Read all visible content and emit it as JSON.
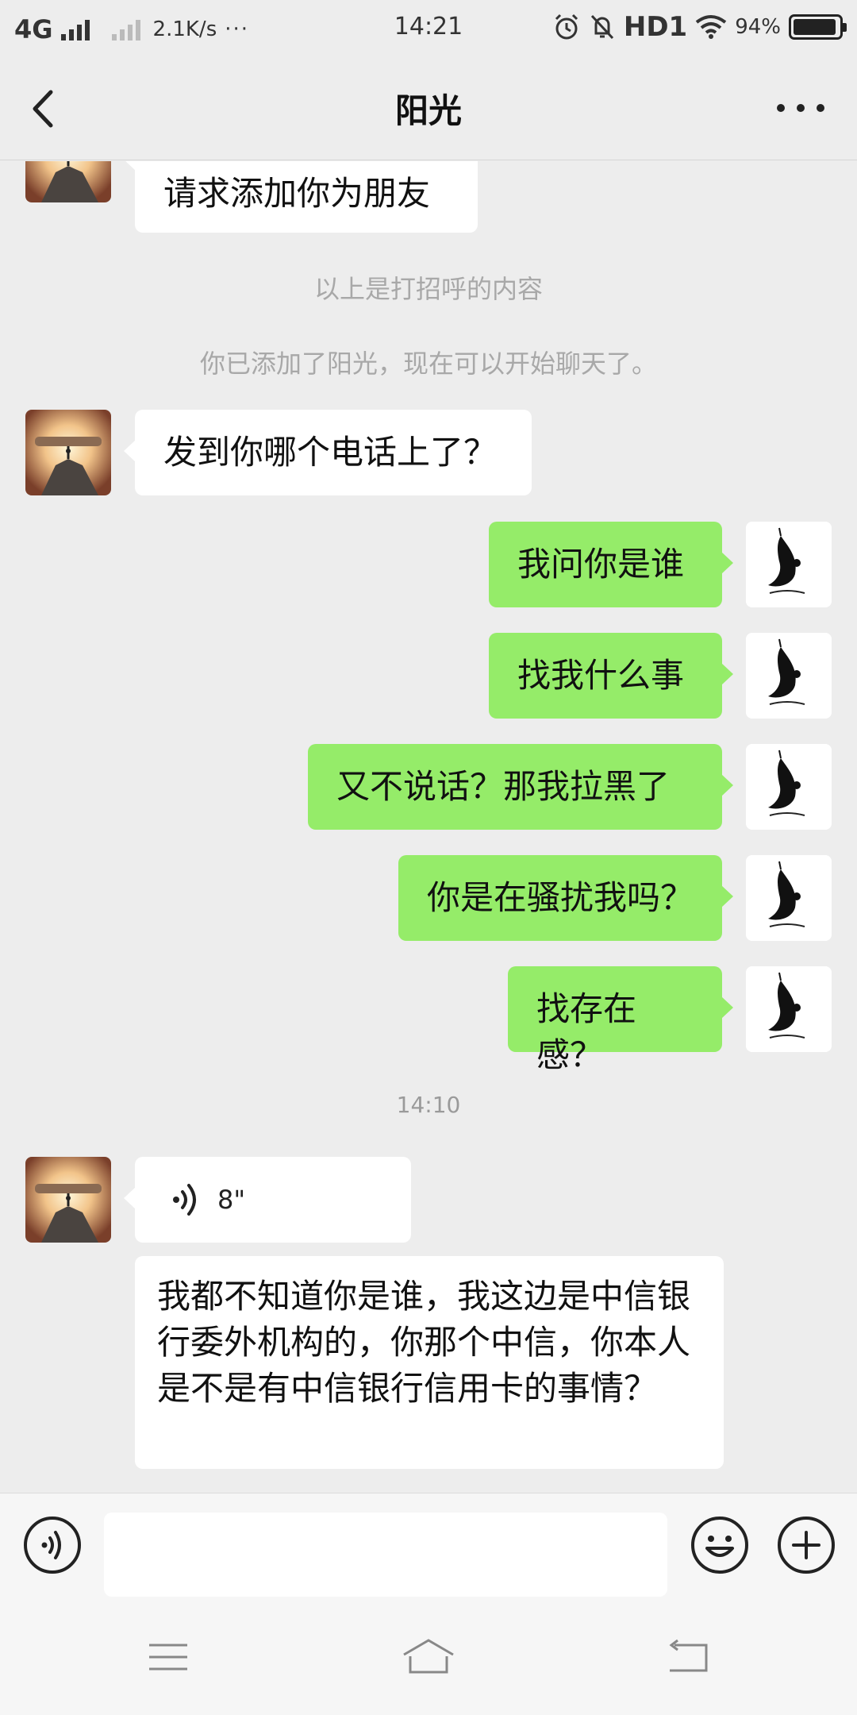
{
  "status_bar": {
    "network": "4G",
    "speed": "2.1K/s",
    "more": "···",
    "time": "14:21",
    "hd": "HD1",
    "battery_text": "94%",
    "battery_level": 0.94
  },
  "header": {
    "title": "阳光"
  },
  "messages": {
    "greeting_request": "请求添加你为朋友",
    "sys_greeting": "以上是打招呼的内容",
    "sys_added": "你已添加了阳光，现在可以开始聊天了。",
    "msg_phone": "发到你哪个电话上了？",
    "out_1": "我问你是谁",
    "out_2": "找我什么事",
    "out_3": "又不说话？那我拉黑了",
    "out_4": "你是在骚扰我吗？",
    "out_5": "找存在感？",
    "timestamp": "14:10",
    "voice_duration": "8\"",
    "transcript": "我都不知道你是谁，我这边是中信银行委外机构的，你那个中信，你本人是不是有中信银行信用卡的事情？"
  },
  "input": {
    "placeholder": ""
  },
  "icons": {
    "back": "chevron-left-icon",
    "more": "more-dots-icon",
    "voice": "voice-icon",
    "emoji": "emoji-icon",
    "plus": "plus-icon"
  },
  "colors": {
    "out_bubble": "#95ec69",
    "in_bubble": "#ffffff",
    "background": "#ededed"
  }
}
